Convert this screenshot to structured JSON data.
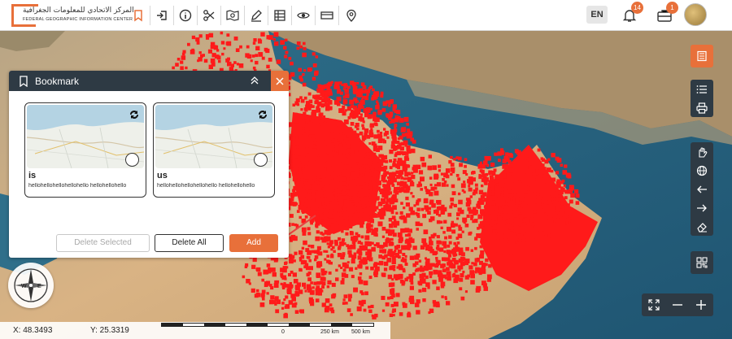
{
  "header": {
    "logo_arabic": "المركز الاتحادي للمعلومات الجغرافية",
    "logo_english": "FEDERAL GEOGRAPHIC INFORMATION CENTER",
    "language": "EN",
    "notifications_count": "14",
    "briefcase_count": "1"
  },
  "toolbar": {
    "icons": [
      "bookmark-icon",
      "login-icon",
      "info-icon",
      "scissors-icon",
      "map-search-icon",
      "draw-icon",
      "table-icon",
      "eye-icon",
      "swipe-icon",
      "location-pin-icon"
    ]
  },
  "bookmark": {
    "title": "Bookmark",
    "cards": [
      {
        "name": "is",
        "description": "hellohellohellohellohello hellohellohello"
      },
      {
        "name": "us",
        "description": "hellohellohellohellohello hellohellohello"
      }
    ],
    "delete_selected_label": "Delete Selected",
    "delete_all_label": "Delete All",
    "add_label": "Add"
  },
  "right_toolbar": {
    "top": [
      "layers-list-icon"
    ],
    "group1": [
      "list-icon",
      "print-icon"
    ],
    "group2": [
      "pan-hand-icon",
      "globe-icon",
      "arrow-left-icon",
      "arrow-right-icon",
      "eraser-icon"
    ],
    "single": [
      "qr-code-icon"
    ]
  },
  "coords": {
    "x": "X: 48.3493",
    "y": "Y: 25.3319"
  },
  "scale": {
    "zero": "0",
    "mid": "250 km",
    "max": "500 km"
  },
  "compass": {
    "west": "W",
    "east": "E"
  },
  "colors": {
    "accent": "#e8703a",
    "panel_header": "#2e3a44",
    "points": "#ff1a1a"
  }
}
